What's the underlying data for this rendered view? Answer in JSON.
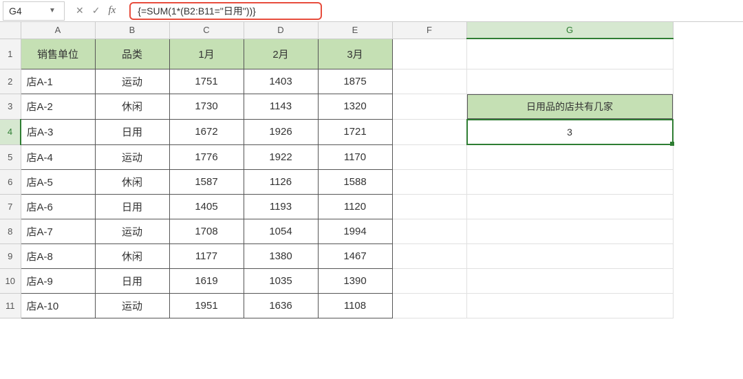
{
  "name_box": "G4",
  "formula": "{=SUM(1*(B2:B11=\"日用\"))}",
  "columns": [
    "A",
    "B",
    "C",
    "D",
    "E",
    "F",
    "G"
  ],
  "selected_col": "G",
  "selected_row": 4,
  "table": {
    "headers": [
      "销售单位",
      "品类",
      "1月",
      "2月",
      "3月"
    ],
    "rows": [
      [
        "店A-1",
        "运动",
        "1751",
        "1403",
        "1875"
      ],
      [
        "店A-2",
        "休闲",
        "1730",
        "1143",
        "1320"
      ],
      [
        "店A-3",
        "日用",
        "1672",
        "1926",
        "1721"
      ],
      [
        "店A-4",
        "运动",
        "1776",
        "1922",
        "1170"
      ],
      [
        "店A-5",
        "休闲",
        "1587",
        "1126",
        "1588"
      ],
      [
        "店A-6",
        "日用",
        "1405",
        "1193",
        "1120"
      ],
      [
        "店A-7",
        "运动",
        "1708",
        "1054",
        "1994"
      ],
      [
        "店A-8",
        "休闲",
        "1177",
        "1380",
        "1467"
      ],
      [
        "店A-9",
        "日用",
        "1619",
        "1035",
        "1390"
      ],
      [
        "店A-10",
        "运动",
        "1951",
        "1636",
        "1108"
      ]
    ]
  },
  "side": {
    "header": "日用品的店共有几家",
    "value": "3"
  },
  "chart_data": {
    "type": "table",
    "title": "",
    "columns": [
      "销售单位",
      "品类",
      "1月",
      "2月",
      "3月"
    ],
    "rows": [
      [
        "店A-1",
        "运动",
        1751,
        1403,
        1875
      ],
      [
        "店A-2",
        "休闲",
        1730,
        1143,
        1320
      ],
      [
        "店A-3",
        "日用",
        1672,
        1926,
        1721
      ],
      [
        "店A-4",
        "运动",
        1776,
        1922,
        1170
      ],
      [
        "店A-5",
        "休闲",
        1587,
        1126,
        1588
      ],
      [
        "店A-6",
        "日用",
        1405,
        1193,
        1120
      ],
      [
        "店A-7",
        "运动",
        1708,
        1054,
        1994
      ],
      [
        "店A-8",
        "休闲",
        1177,
        1380,
        1467
      ],
      [
        "店A-9",
        "日用",
        1619,
        1035,
        1390
      ],
      [
        "店A-10",
        "运动",
        1951,
        1636,
        1108
      ]
    ],
    "summary": {
      "label": "日用品的店共有几家",
      "value": 3
    }
  }
}
